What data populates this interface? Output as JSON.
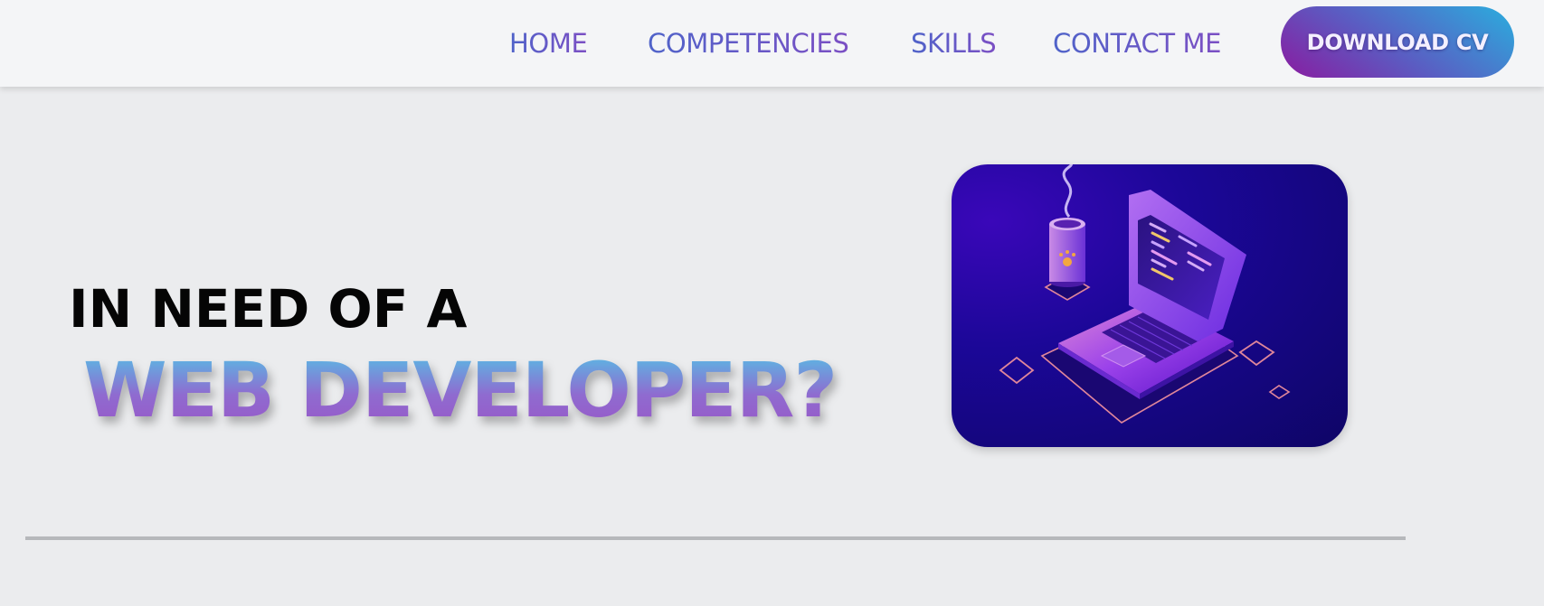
{
  "nav": {
    "items": [
      {
        "label": "HOME"
      },
      {
        "label": "COMPETENCIES"
      },
      {
        "label": "SKILLS"
      },
      {
        "label": "CONTACT ME"
      }
    ],
    "cta_label": "DOWNLOAD CV"
  },
  "hero": {
    "line1": "IN NEED OF A",
    "line2": "WEB DEVELOPER?",
    "image_icon": "laptop-coffee-illustration"
  },
  "colors": {
    "nav_text": "#5a5ec8",
    "cta_gradient_start": "#8a1ba0",
    "cta_gradient_end": "#2aaede",
    "headline_gradient_top": "#4ecbe8",
    "headline_gradient_bottom": "#9a55c6",
    "illustration_bg": "#1b0797"
  }
}
